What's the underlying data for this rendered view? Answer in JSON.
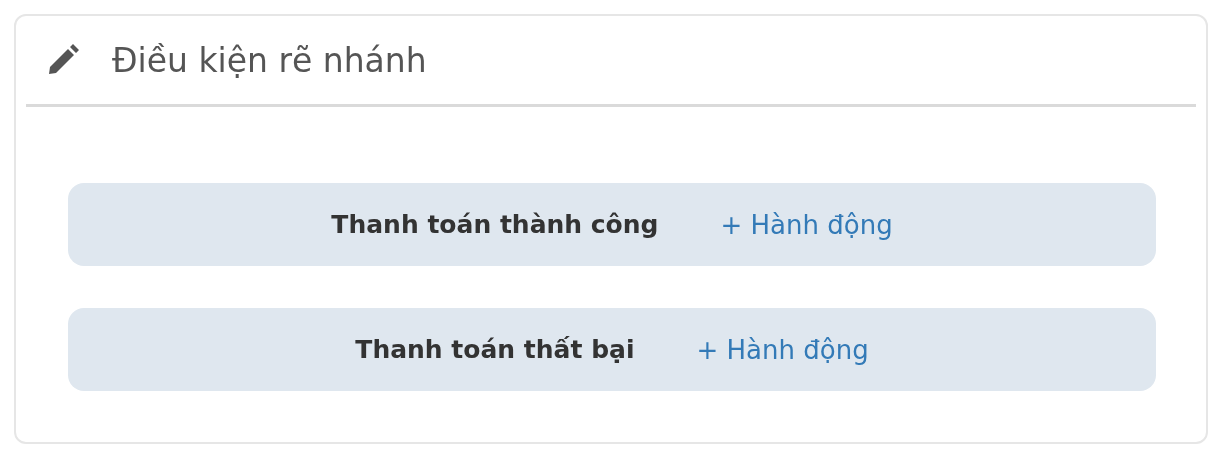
{
  "panel": {
    "title": "Điều kiện rẽ nhánh"
  },
  "branches": [
    {
      "label": "Thanh toán thành công",
      "action": "+ Hành động"
    },
    {
      "label": "Thanh toán thất bại",
      "action": "+ Hành động"
    }
  ]
}
